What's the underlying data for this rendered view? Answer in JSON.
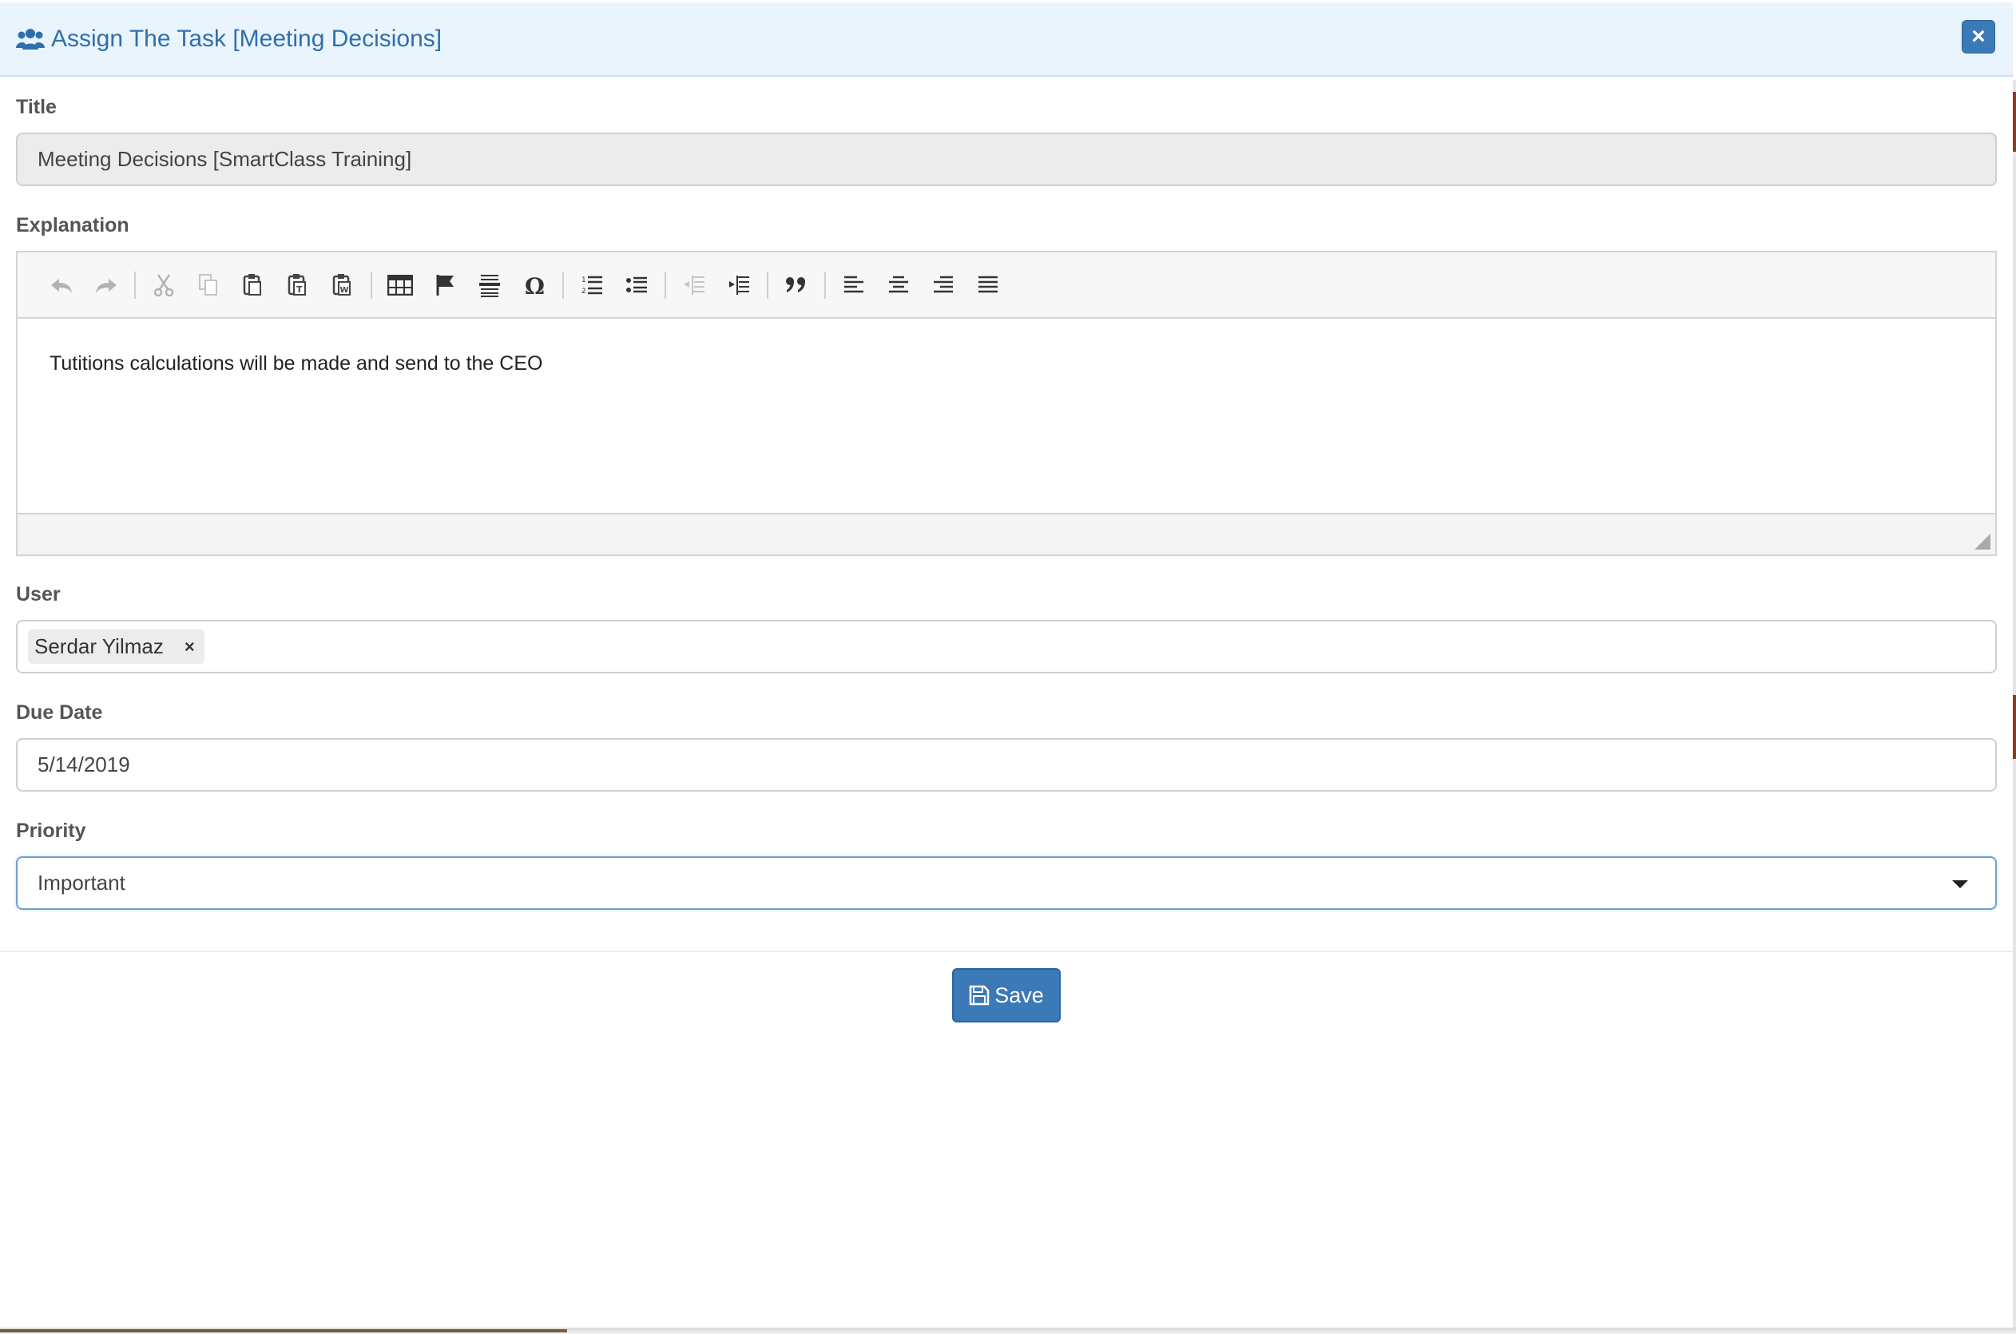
{
  "header": {
    "title": "Assign The Task [Meeting Decisions]",
    "icon": "users-icon",
    "close_label": "×",
    "accent": "#2f6fad"
  },
  "form": {
    "title_label": "Title",
    "title_value": "Meeting Decisions [SmartClass Training]",
    "explanation_label": "Explanation",
    "explanation_text": "Tutitions calculations will be made and send to the CEO",
    "user_label": "User",
    "user_tag": "Serdar Yilmaz",
    "user_tag_remove": "×",
    "due_date_label": "Due Date",
    "due_date_value": "5/14/2019",
    "priority_label": "Priority",
    "priority_value": "Important"
  },
  "toolbar": {
    "buttons": [
      "undo-icon",
      "redo-icon",
      "cut-icon",
      "copy-icon",
      "paste-icon",
      "paste-text-icon",
      "paste-word-icon",
      "table-icon",
      "anchor-icon",
      "horizontal-line-icon",
      "special-char-icon",
      "numbered-list-icon",
      "bulleted-list-icon",
      "outdent-icon",
      "indent-icon",
      "blockquote-icon",
      "align-left-icon",
      "align-center-icon",
      "align-right-icon",
      "justify-icon"
    ]
  },
  "footer": {
    "save_label": "Save",
    "button_color": "#3c79b7"
  }
}
